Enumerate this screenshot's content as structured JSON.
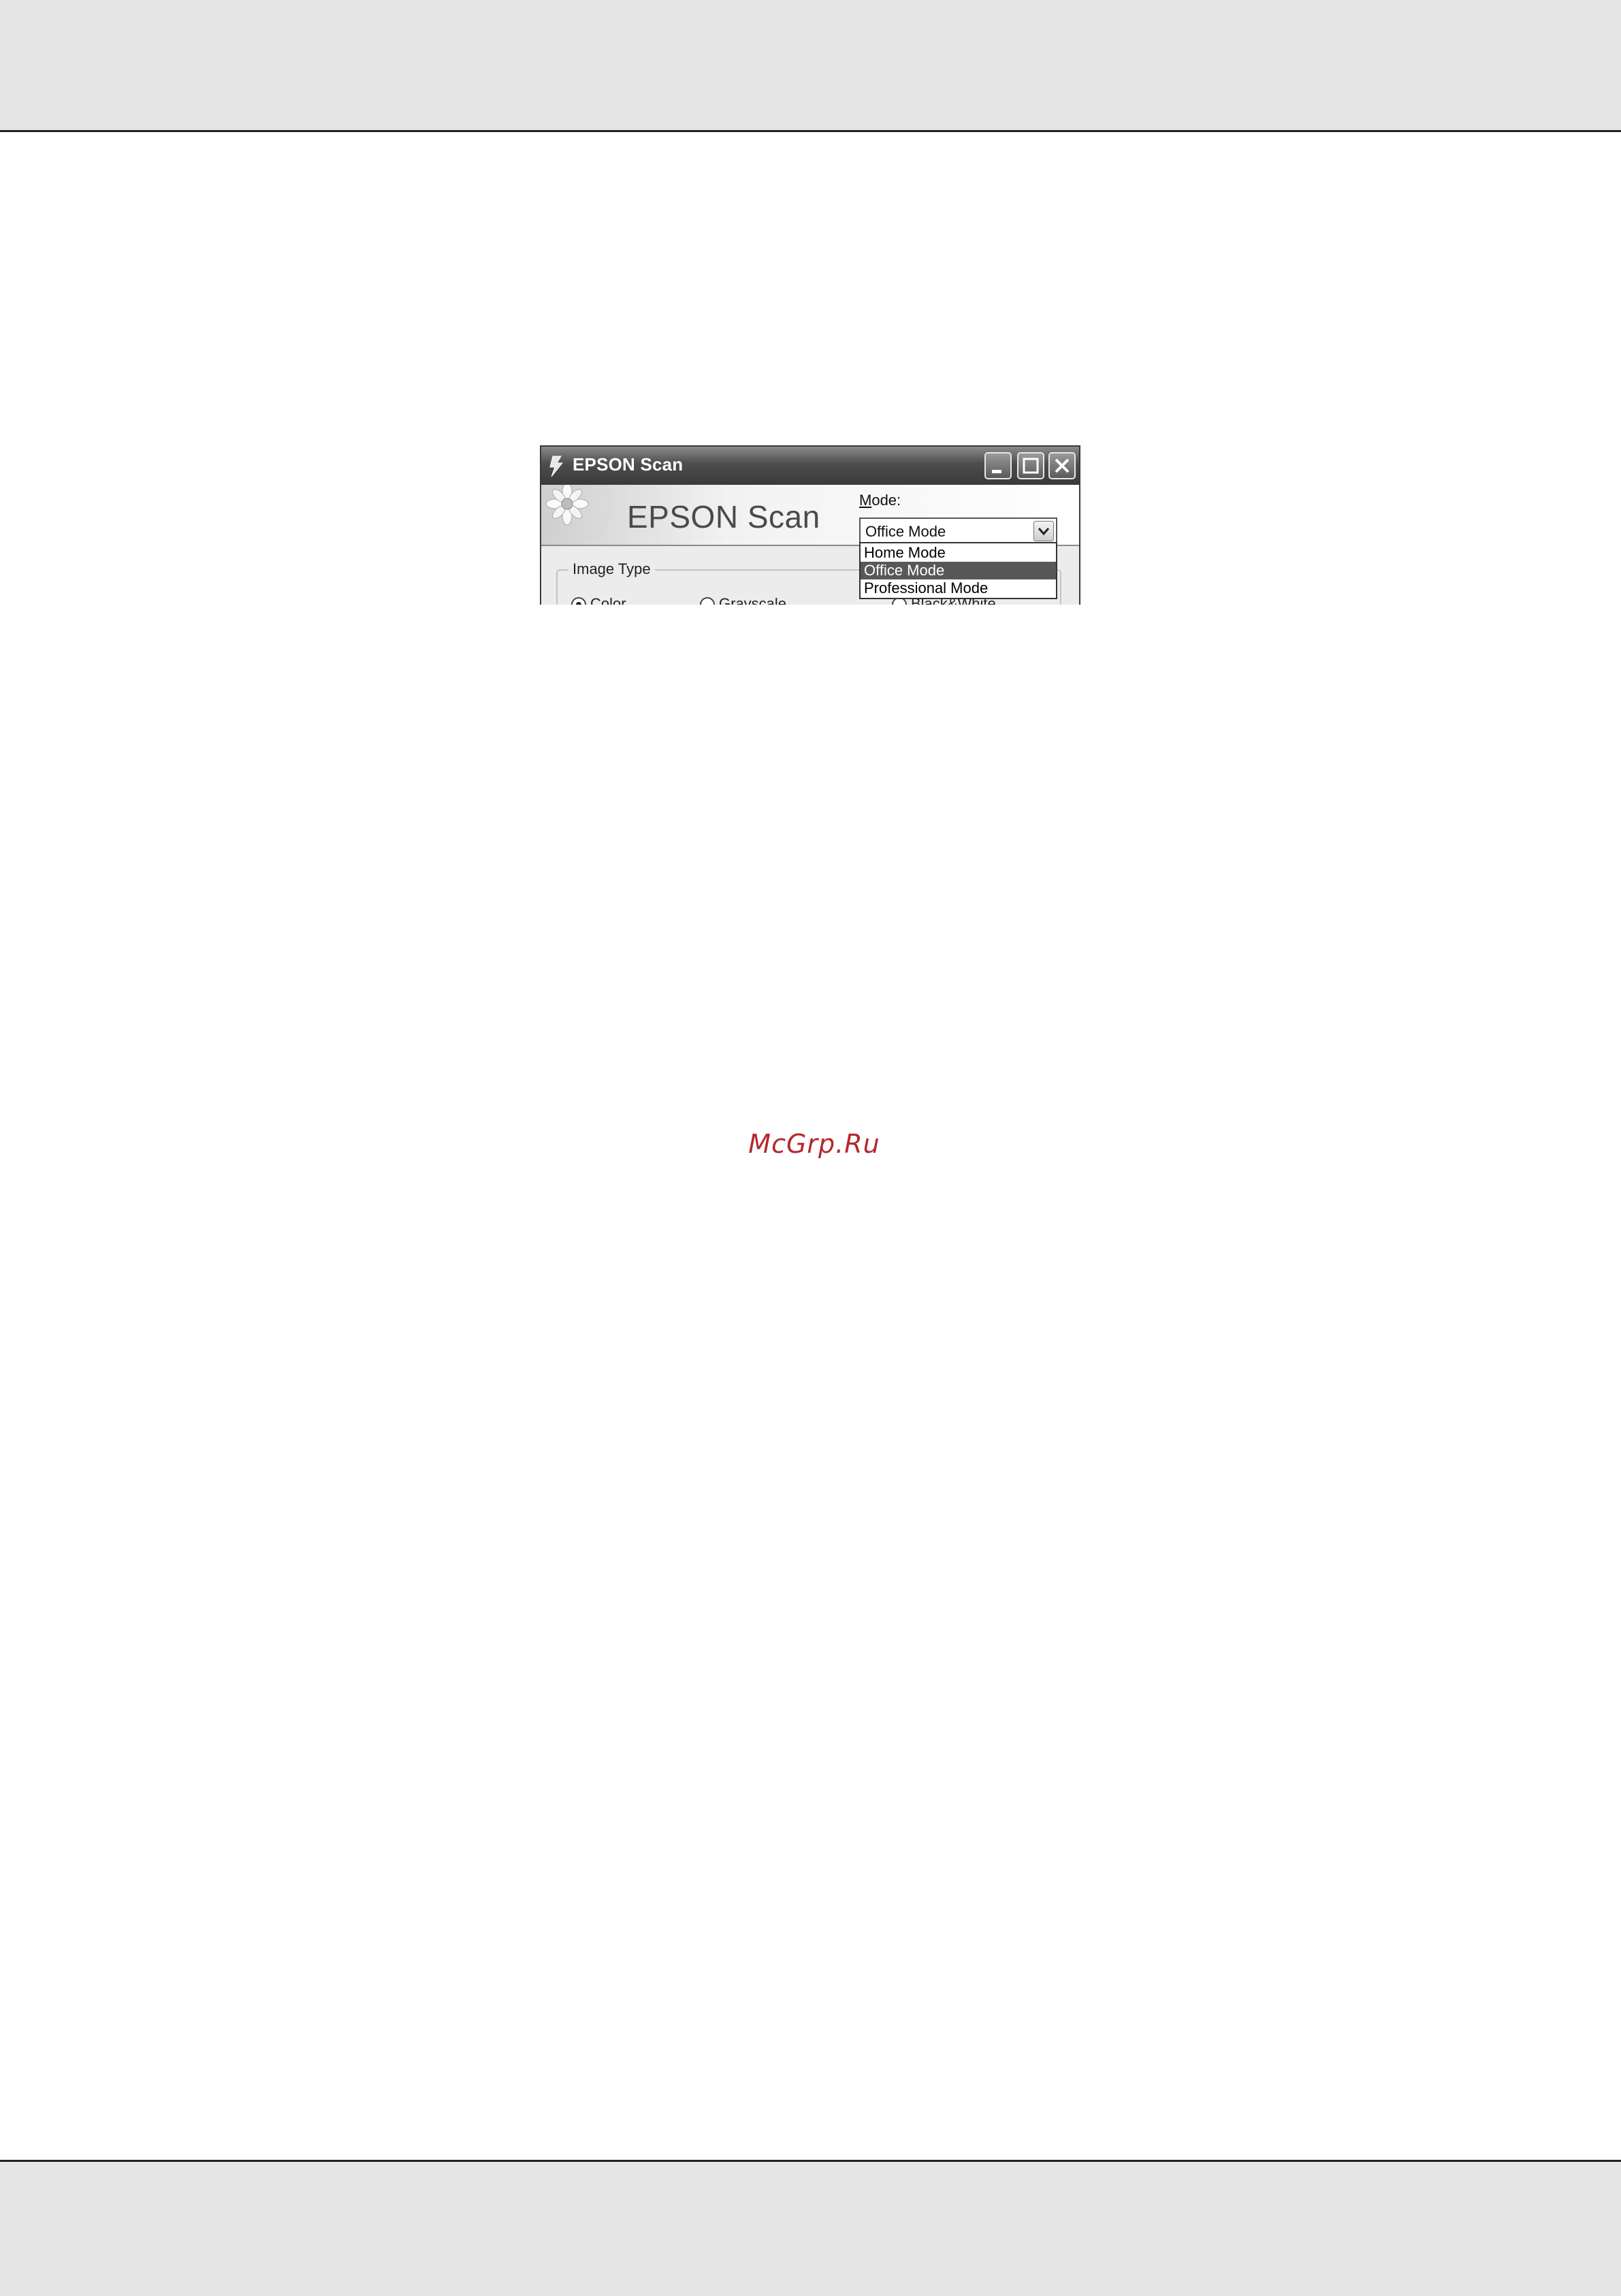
{
  "window": {
    "title": "EPSON Scan",
    "brand": "EPSON Scan"
  },
  "mode": {
    "label_prefix": "M",
    "label_rest": "ode:",
    "selected": "Office Mode",
    "options": [
      "Home Mode",
      "Office Mode",
      "Professional Mode"
    ],
    "highlighted_index": 1
  },
  "image_type": {
    "title": "Image Type",
    "options": [
      "Color",
      "Grayscale",
      "Black&White"
    ],
    "selected": "Color"
  },
  "watermark": "McGrp.Ru",
  "colors": {
    "highlight": "#585858",
    "watermark": "#b5282e",
    "page_band": "#e5e5e5"
  },
  "icons": [
    "scanner-icon",
    "minimize-icon",
    "maximize-icon",
    "close-icon",
    "chevron-down-icon",
    "flower-logo"
  ]
}
